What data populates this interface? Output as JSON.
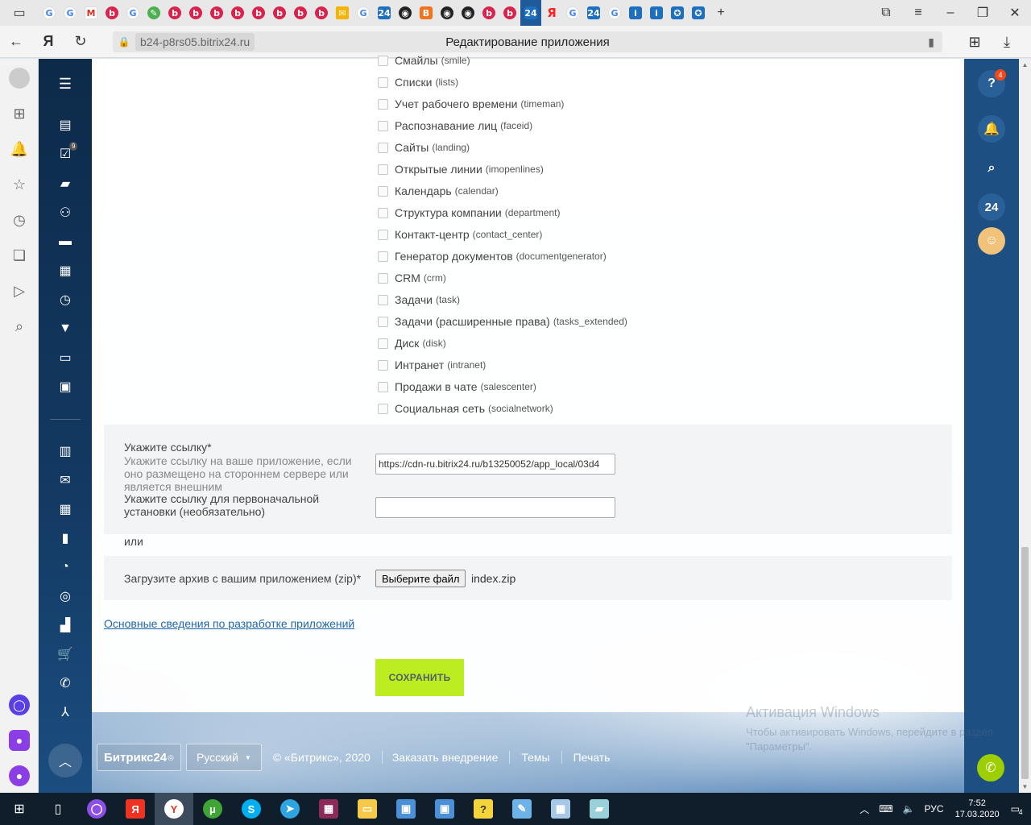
{
  "browser": {
    "page_title": "Редактирование приложения",
    "domain": "b24-p8rs05.bitrix24.ru",
    "tabs": [
      {
        "icon": "google-favicon",
        "glyph": "G",
        "style": "g"
      },
      {
        "icon": "google-favicon",
        "glyph": "G",
        "style": "g"
      },
      {
        "icon": "gmail-favicon",
        "glyph": "M",
        "style": "gm"
      },
      {
        "icon": "bitrix-favicon",
        "glyph": "b",
        "style": "red"
      },
      {
        "icon": "google-favicon",
        "glyph": "G",
        "style": "g"
      },
      {
        "icon": "plugin-favicon",
        "glyph": "✎",
        "style": "green"
      },
      {
        "icon": "bitrix-favicon",
        "glyph": "b",
        "style": "red"
      },
      {
        "icon": "bitrix-favicon",
        "glyph": "b",
        "style": "red"
      },
      {
        "icon": "bitrix-favicon",
        "glyph": "b",
        "style": "red"
      },
      {
        "icon": "bitrix-favicon",
        "glyph": "b",
        "style": "red"
      },
      {
        "icon": "bitrix-favicon",
        "glyph": "b",
        "style": "red"
      },
      {
        "icon": "bitrix-favicon",
        "glyph": "b",
        "style": "red"
      },
      {
        "icon": "bitrix-favicon",
        "glyph": "b",
        "style": "red"
      },
      {
        "icon": "bitrix-favicon",
        "glyph": "b",
        "style": "red"
      },
      {
        "icon": "yandex-mail-favicon",
        "glyph": "✉",
        "style": "mail"
      },
      {
        "icon": "google-favicon",
        "glyph": "G",
        "style": "g"
      },
      {
        "icon": "bitrix24-favicon",
        "glyph": "24",
        "style": "blue"
      },
      {
        "icon": "github-favicon",
        "glyph": "◉",
        "style": "dark"
      },
      {
        "icon": "blogger-favicon",
        "glyph": "B",
        "style": "orange"
      },
      {
        "icon": "github-favicon",
        "glyph": "◉",
        "style": "dark"
      },
      {
        "icon": "github-favicon",
        "glyph": "◉",
        "style": "dark"
      },
      {
        "icon": "bitrix-favicon",
        "glyph": "b",
        "style": "red"
      },
      {
        "icon": "bitrix-favicon",
        "glyph": "b",
        "style": "red"
      },
      {
        "icon": "bitrix24-favicon",
        "glyph": "24",
        "style": "blue",
        "active": true
      },
      {
        "icon": "yandex-favicon",
        "glyph": "Я",
        "style": "ya"
      },
      {
        "icon": "google-favicon",
        "glyph": "G",
        "style": "g"
      },
      {
        "icon": "bitrix24-favicon",
        "glyph": "24",
        "style": "blue"
      },
      {
        "icon": "google-favicon",
        "glyph": "G",
        "style": "g"
      },
      {
        "icon": "info-favicon",
        "glyph": "i",
        "style": "blue"
      },
      {
        "icon": "info-favicon",
        "glyph": "i",
        "style": "blue"
      },
      {
        "icon": "emblem-favicon",
        "glyph": "✪",
        "style": "blue"
      },
      {
        "icon": "emblem-favicon",
        "glyph": "✪",
        "style": "blue"
      }
    ]
  },
  "scopes": [
    {
      "name": "Смайлы",
      "code": "(smile)"
    },
    {
      "name": "Списки",
      "code": "(lists)"
    },
    {
      "name": "Учет рабочего времени",
      "code": "(timeman)"
    },
    {
      "name": "Распознавание лиц",
      "code": "(faceid)"
    },
    {
      "name": "Сайты",
      "code": "(landing)"
    },
    {
      "name": "Открытые линии",
      "code": "(imopenlines)"
    },
    {
      "name": "Календарь",
      "code": "(calendar)"
    },
    {
      "name": "Структура компании",
      "code": "(department)"
    },
    {
      "name": "Контакт-центр",
      "code": "(contact_center)"
    },
    {
      "name": "Генератор документов",
      "code": "(documentgenerator)"
    },
    {
      "name": "CRM",
      "code": "(crm)"
    },
    {
      "name": "Задачи",
      "code": "(task)"
    },
    {
      "name": "Задачи (расширенные права)",
      "code": "(tasks_extended)"
    },
    {
      "name": "Диск",
      "code": "(disk)"
    },
    {
      "name": "Интранет",
      "code": "(intranet)"
    },
    {
      "name": "Продажи в чате",
      "code": "(salescenter)"
    },
    {
      "name": "Социальная сеть",
      "code": "(socialnetwork)"
    }
  ],
  "form": {
    "link_label": "Укажите ссылку*",
    "link_hint": "Укажите ссылку на ваше приложение, если оно размещено на стороннем сервере или является внешним",
    "link_value": "https://cdn-ru.bitrix24.ru/b13250052/app_local/03d4",
    "install_label": "Укажите ссылку для первоначальной установки (необязательно)",
    "install_value": "",
    "or_text": "или",
    "zip_label": "Загрузите архив с вашим приложением (zip)*",
    "file_button": "Выберите файл",
    "file_name": "index.zip",
    "dev_link": "Основные сведения по разработке приложений",
    "save_button": "СОХРАНИТЬ"
  },
  "left_menu": {
    "tasks_counter": "9"
  },
  "right_panel": {
    "help_badge": "4",
    "b24_label": "24"
  },
  "footer": {
    "logo": "Битрикс24",
    "language": "Русский",
    "copyright": "© «Битрикс», 2020",
    "links": [
      "Заказать внедрение",
      "Темы",
      "Печать"
    ]
  },
  "watermark": {
    "title": "Активация Windows",
    "text": "Чтобы активировать Windows, перейдите в раздел \"Параметры\"."
  },
  "taskbar": {
    "lang": "РУС",
    "time": "7:52",
    "date": "17.03.2020",
    "notifications": "4"
  },
  "colors": {
    "save_button": "#bbed21",
    "menu_bg": "#0d2a49",
    "right_panel_bg": "#1e4f83",
    "link": "#2067b0"
  }
}
